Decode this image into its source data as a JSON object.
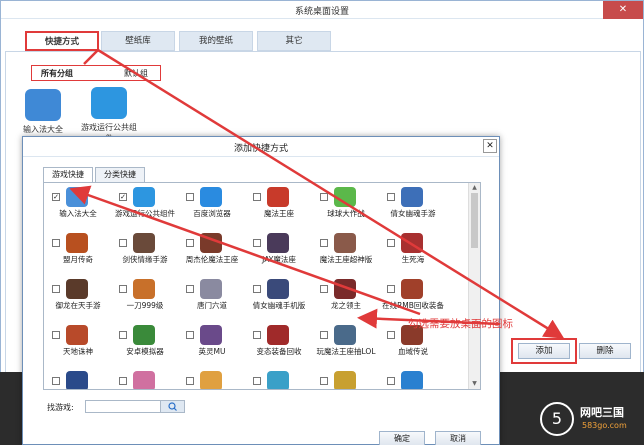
{
  "main": {
    "title": "系统桌面设置",
    "close": "✕",
    "tabs": [
      {
        "label": "快捷方式"
      },
      {
        "label": "壁纸库"
      },
      {
        "label": "我的壁纸"
      },
      {
        "label": "其它"
      }
    ],
    "subtabs": [
      {
        "label": "所有分组"
      },
      {
        "label": "默认组"
      }
    ],
    "desktop_items": [
      {
        "label": "输入法大全",
        "color": "#3f89d6"
      },
      {
        "label": "游戏运行公共组件",
        "color": "#2d96e0"
      }
    ],
    "buttons": {
      "add": "添加",
      "delete": "删除"
    }
  },
  "dialog": {
    "title": "添加快捷方式",
    "close": "✕",
    "tabs": [
      {
        "label": "游戏快捷"
      },
      {
        "label": "分类快捷"
      }
    ],
    "games": [
      {
        "label": "输入法大全",
        "checked": true,
        "color": "#4a90d9"
      },
      {
        "label": "游戏运行公共组件",
        "checked": true,
        "color": "#2d96e0"
      },
      {
        "label": "百度浏览器",
        "checked": false,
        "color": "#2a8be0"
      },
      {
        "label": "魔法王座",
        "checked": false,
        "color": "#c83a2a"
      },
      {
        "label": "球球大作战",
        "checked": false,
        "color": "#5bb84a"
      },
      {
        "label": "倩女幽魂手游",
        "checked": false,
        "color": "#3d6fb8"
      },
      {
        "label": "盟月传奇",
        "checked": false,
        "color": "#b8501f"
      },
      {
        "label": "剑侠情缘手游",
        "checked": false,
        "color": "#6a4a3a"
      },
      {
        "label": "周杰伦魔法王座",
        "checked": false,
        "color": "#7a3a2a"
      },
      {
        "label": "JAY魔法座",
        "checked": false,
        "color": "#4a3a5a"
      },
      {
        "label": "魔法王座超神版",
        "checked": false,
        "color": "#8a5a4a"
      },
      {
        "label": "生死海",
        "checked": false,
        "color": "#a83030"
      },
      {
        "label": "御龙在天手游",
        "checked": false,
        "color": "#5a3a2a"
      },
      {
        "label": "一刀999级",
        "checked": false,
        "color": "#c8702a"
      },
      {
        "label": "唐门六道",
        "checked": false,
        "color": "#8a8aa0"
      },
      {
        "label": "倩女幽魂手机版",
        "checked": false,
        "color": "#3a4a7a"
      },
      {
        "label": "龙之领主",
        "checked": false,
        "color": "#7a2a2a"
      },
      {
        "label": "在线RMB回收装备",
        "checked": false,
        "color": "#a0402a"
      },
      {
        "label": "天地诛神",
        "checked": false,
        "color": "#b84a2a"
      },
      {
        "label": "安卓模拟器",
        "checked": false,
        "color": "#3a8a3a"
      },
      {
        "label": "英灵MU",
        "checked": false,
        "color": "#6a4a8a"
      },
      {
        "label": "变态装备回收",
        "checked": false,
        "color": "#a02a2a"
      },
      {
        "label": "玩魔法王座抽LOL",
        "checked": false,
        "color": "#4a6a8a"
      },
      {
        "label": "血域传说",
        "checked": false,
        "color": "#8a3a2a"
      },
      {
        "label": "",
        "checked": false,
        "color": "#2a4a8a"
      },
      {
        "label": "",
        "checked": false,
        "color": "#d070a0"
      },
      {
        "label": "",
        "checked": false,
        "color": "#e0a040"
      },
      {
        "label": "",
        "checked": false,
        "color": "#3aa0c8"
      },
      {
        "label": "",
        "checked": false,
        "color": "#c8a030"
      },
      {
        "label": "",
        "checked": false,
        "color": "#2a80d0"
      }
    ],
    "search_label": "找游戏:",
    "search_placeholder": "",
    "ok": "确定",
    "cancel": "取消"
  },
  "annotation": "勾选需要放桌面的图标",
  "logo": {
    "circle": "5",
    "name": "网吧三国",
    "url": "583go.com"
  },
  "colors": {
    "highlight": "#e03a3a",
    "taskbar": "#2c2c2c"
  }
}
